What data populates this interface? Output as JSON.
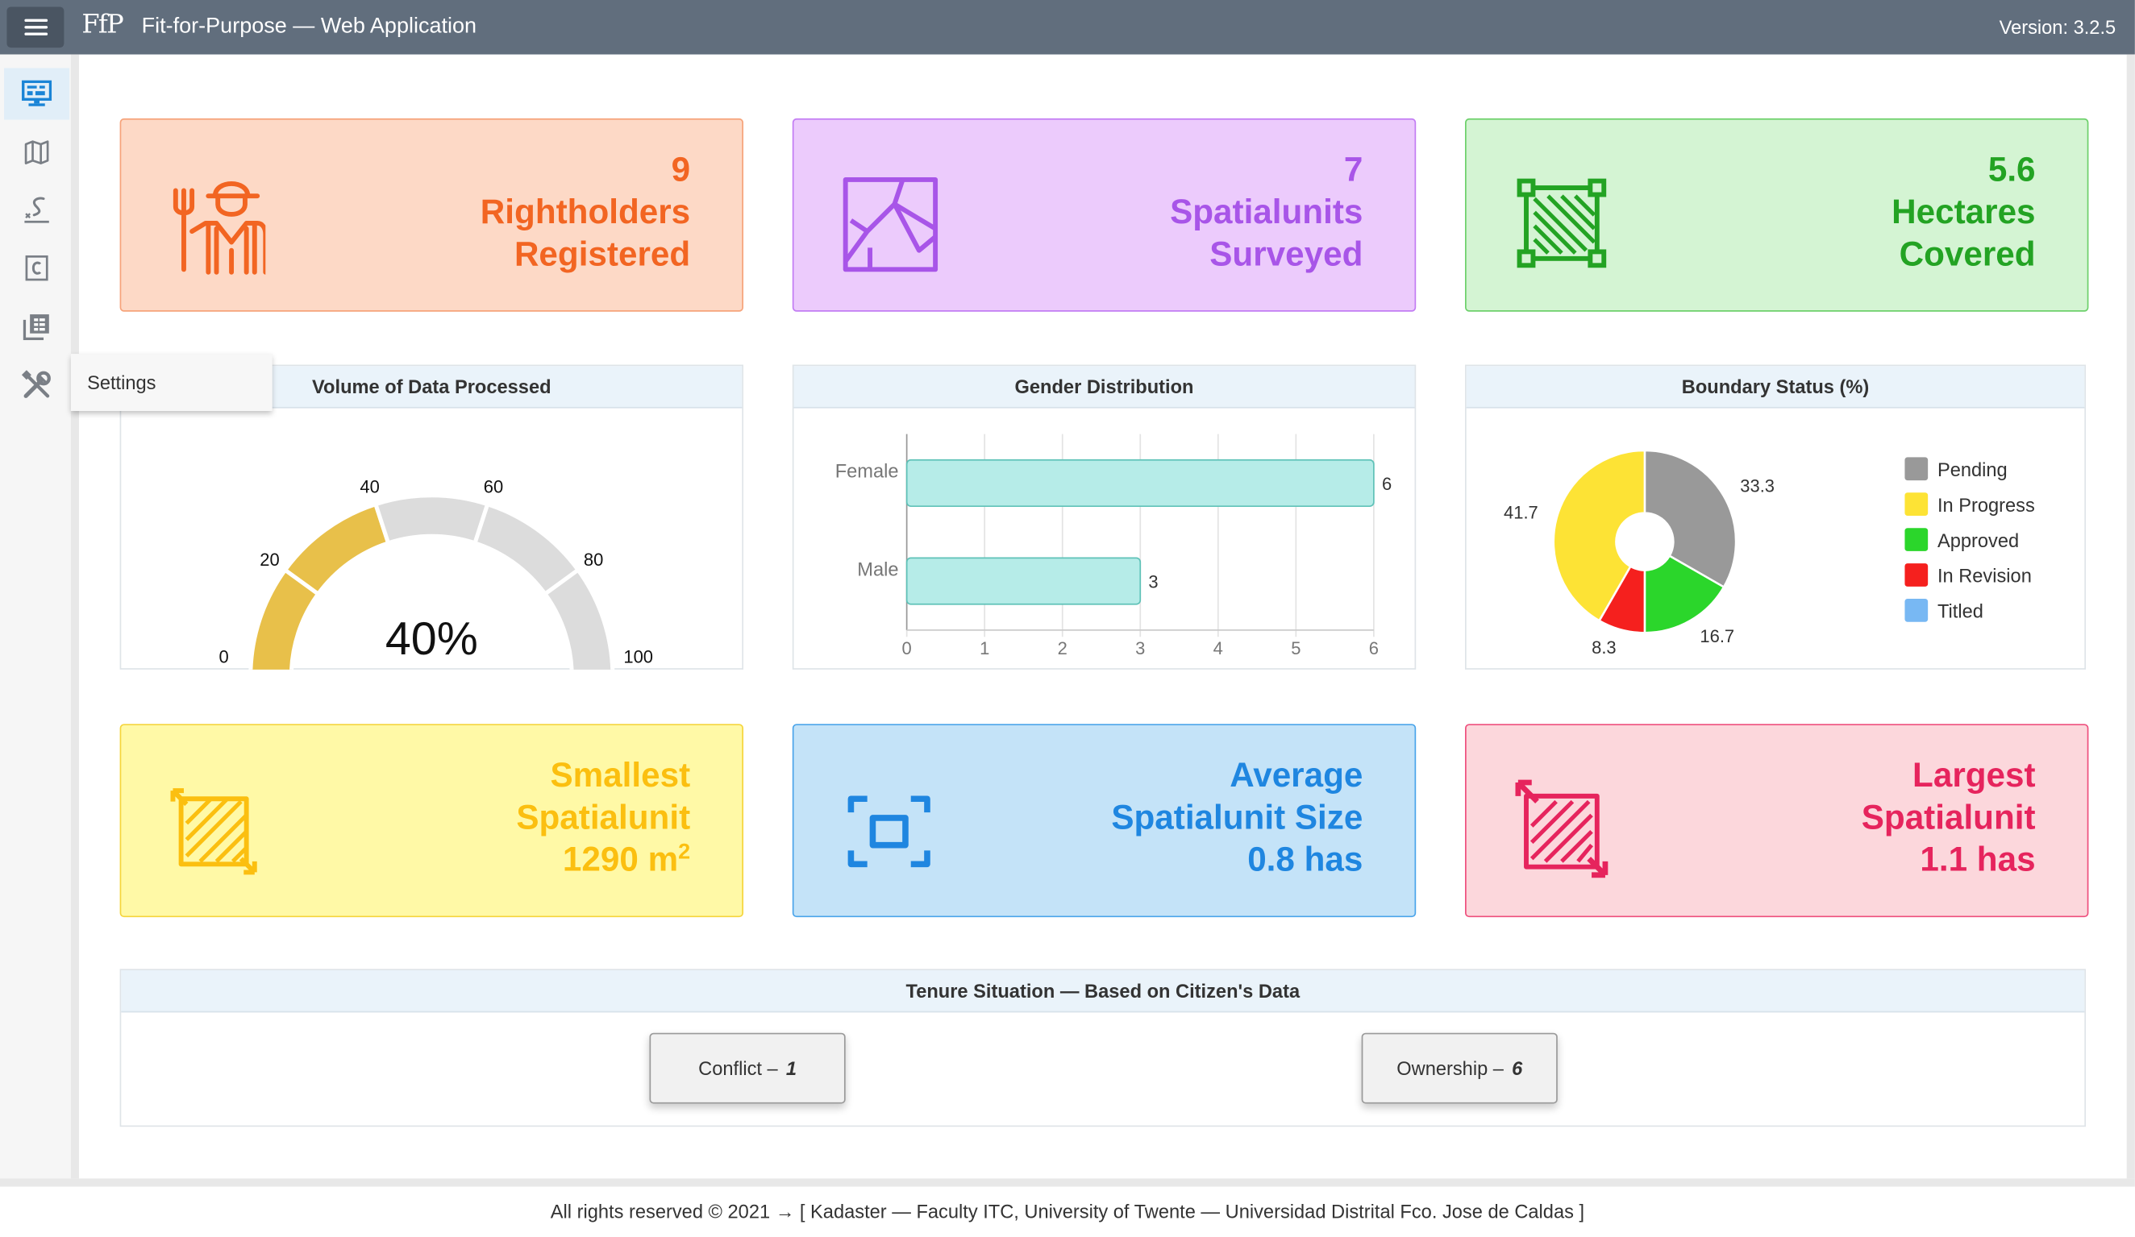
{
  "header": {
    "logo": "FfP",
    "title": "Fit-for-Purpose — Web Application",
    "version": "Version: 3.2.5"
  },
  "sidebar": {
    "items": [
      {
        "icon": "dashboard-icon",
        "active": true
      },
      {
        "icon": "map-icon"
      },
      {
        "icon": "survey-icon"
      },
      {
        "icon": "certificate-icon"
      },
      {
        "icon": "reports-icon"
      },
      {
        "icon": "settings-icon"
      }
    ],
    "tooltip": "Settings"
  },
  "stats": {
    "rightholders": {
      "value": "9",
      "line1": "Rightholders",
      "line2": "Registered",
      "color": "#f26522",
      "bg": "#fdd9c6"
    },
    "spatialunits": {
      "value": "7",
      "line1": "Spatialunits",
      "line2": "Surveyed",
      "color": "#a855e8",
      "bg": "#eccbfc"
    },
    "hectares": {
      "value": "5.6",
      "line1": "Hectares",
      "line2": "Covered",
      "color": "#23a323",
      "bg": "#d4f4d3"
    },
    "smallest": {
      "line1": "Smallest",
      "line2": "Spatialunit",
      "value": "1290 m",
      "sup": "2",
      "color": "#fbbf10",
      "bg": "#fff9a6"
    },
    "average": {
      "line1": "Average",
      "line2": "Spatialunit Size",
      "value": "0.8 has",
      "color": "#1f86e0",
      "bg": "#c4e3f8"
    },
    "largest": {
      "line1": "Largest",
      "line2": "Spatialunit",
      "value": "1.1 has",
      "color": "#e6245d",
      "bg": "#fcd7dc"
    }
  },
  "panels": {
    "volume": {
      "title": "Volume of Data Processed"
    },
    "gender": {
      "title": "Gender Distribution"
    },
    "boundary": {
      "title": "Boundary Status (%)"
    },
    "tenure": {
      "title": "Tenure Situation — Based on Citizen's Data"
    }
  },
  "chart_data": [
    {
      "type": "gauge",
      "title": "Volume of Data Processed",
      "value": 40,
      "value_label": "40%",
      "range": [
        0,
        100
      ],
      "ticks": [
        "0",
        "20",
        "40",
        "60",
        "80",
        "100"
      ],
      "fill_color": "#e8c04a",
      "track_color": "#dcdcdc"
    },
    {
      "type": "bar",
      "orientation": "horizontal",
      "title": "Gender Distribution",
      "categories": [
        "Female",
        "Male"
      ],
      "values": [
        6,
        3
      ],
      "xlim": [
        0,
        6
      ],
      "xticks": [
        "0",
        "1",
        "2",
        "3",
        "4",
        "5",
        "6"
      ],
      "bar_color": "#b6ece8",
      "bar_border": "#5fc2b8",
      "grid": true
    },
    {
      "type": "pie",
      "donut": true,
      "title": "Boundary Status (%)",
      "legend_position": "right",
      "slices": [
        {
          "label": "Pending",
          "value": 33.3,
          "display": "33.3",
          "color": "#999999"
        },
        {
          "label": "In Progress",
          "value": 41.7,
          "display": "41.7",
          "color": "#fde335"
        },
        {
          "label": "Approved",
          "value": 16.7,
          "display": "16.7",
          "color": "#2bd62b"
        },
        {
          "label": "In Revision",
          "value": 8.3,
          "display": "8.3",
          "color": "#f5201e"
        },
        {
          "label": "Titled",
          "value": 0,
          "display": "",
          "color": "#78b8f3"
        }
      ]
    }
  ],
  "tenure": {
    "buttons": [
      {
        "label": "Conflict –",
        "count": "1"
      },
      {
        "label": "Ownership –",
        "count": "6"
      }
    ]
  },
  "footer": {
    "text": "All rights reserved © 2021 → [ Kadaster — Faculty ITC, University of Twente — Universidad Distrital Fco. Jose de Caldas ]"
  }
}
